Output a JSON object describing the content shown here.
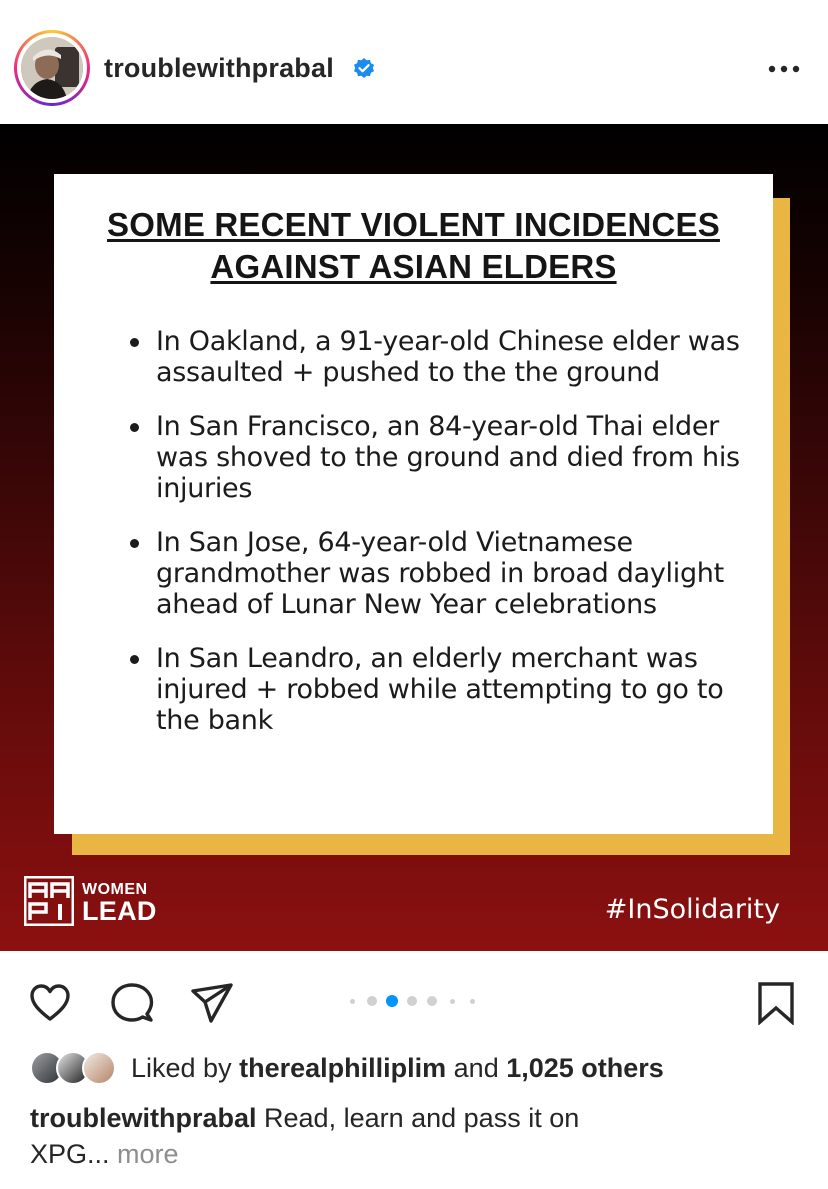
{
  "post": {
    "username": "troublewithprabal",
    "verified": true,
    "more_icon": "ellipsis-horizontal-icon"
  },
  "image": {
    "title_line1": "SOME RECENT VIOLENT INCIDENCES",
    "title_line2": "AGAINST ASIAN ELDERS",
    "bullets": [
      "In Oakland, a 91-year-old Chinese elder was assaulted + pushed to the the ground",
      "In San Francisco, an 84-year-old Thai elder was shoved to the ground and died from his injuries",
      "In San Jose, 64-year-old Vietnamese grandmother was robbed in broad daylight ahead of Lunar New Year celebrations",
      "In San Leandro, an elderly merchant was injured + robbed while attempting to go to the bank"
    ],
    "logo_line1": "WOMEN",
    "logo_line2": "LEAD",
    "logo_mark_text": "AAPI",
    "hashtag": "#InSolidarity",
    "colors": {
      "background_dark": "#000000",
      "background_red": "#8c1010",
      "accent_gold": "#e9b543",
      "card": "#ffffff"
    }
  },
  "actions": {
    "like_icon": "heart-icon",
    "comment_icon": "comment-icon",
    "share_icon": "send-icon",
    "save_icon": "bookmark-icon",
    "carousel": {
      "total": 7,
      "active_index": 2,
      "active_color": "#0095f6"
    }
  },
  "likes": {
    "prefix": "Liked by",
    "user": "therealphilliplim",
    "connector": "and",
    "count": "1,025 others"
  },
  "caption": {
    "username": "troublewithprabal",
    "text": "Read, learn and pass it on",
    "text_line2": "XPG...",
    "more_label": "more"
  }
}
